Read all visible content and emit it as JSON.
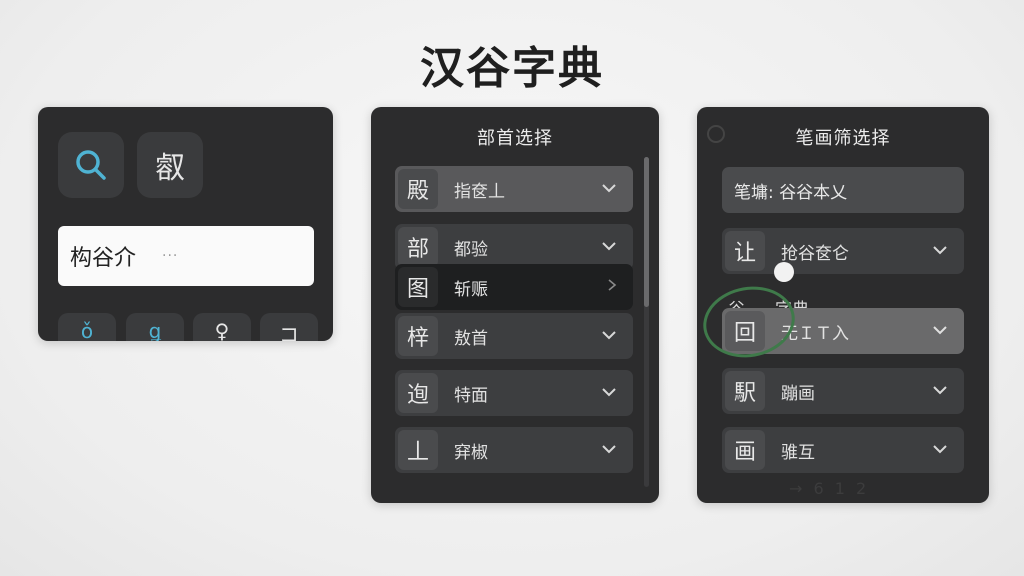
{
  "app": {
    "title": "汉谷字典"
  },
  "panel1": {
    "glyph_button": "㕡",
    "search": {
      "value": "构谷介",
      "suffix": "···"
    },
    "tabs": [
      "ǒ",
      "ǥ",
      "♀",
      "コ"
    ]
  },
  "radical_panel": {
    "title": "部首选择",
    "rows": [
      {
        "glyph": "殿",
        "label": "指奁丄"
      },
      {
        "glyph": "部",
        "label": "都验"
      },
      {
        "glyph": "图",
        "label": "斩赈"
      },
      {
        "glyph": "梓",
        "label": "敖首"
      },
      {
        "glyph": "迿",
        "label": "特面"
      },
      {
        "glyph": "丄",
        "label": "穽椒"
      }
    ]
  },
  "stroke_panel": {
    "title": "笔画筛选择",
    "stroke_field": "笔墉: 谷谷本乂",
    "rows": [
      {
        "glyph": "让",
        "label": "抢谷奁仑"
      },
      {
        "glyph": "回",
        "label": "无ＩＴ入"
      },
      {
        "glyph": "駅",
        "label": "蹦画"
      },
      {
        "glyph": "画",
        "label": "骓互"
      }
    ],
    "floating_glyph": "谷",
    "floating_label": "字典",
    "footer": "→ 6 1 2"
  }
}
